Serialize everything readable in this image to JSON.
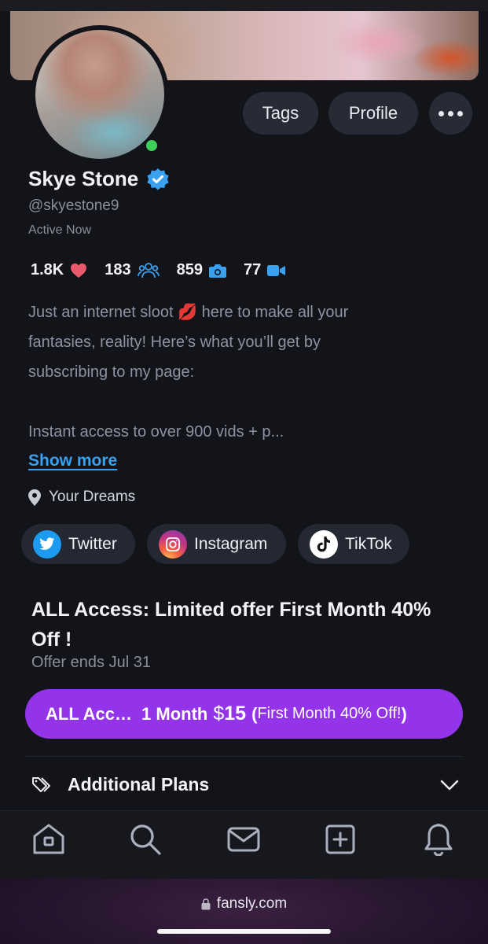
{
  "header": {
    "tags_label": "Tags",
    "profile_label": "Profile"
  },
  "profile": {
    "name": "Skye Stone",
    "handle": "@skyestone9",
    "status": "Active Now",
    "stats": {
      "likes": "1.8K",
      "subscribers": "183",
      "photos": "859",
      "videos": "77"
    },
    "bio_lines": [
      "Just an internet sloot 💋 here to make all your",
      "fantasies, reality! Here’s what you’ll get by",
      "subscribing to my page:",
      "Instant access to over 900 vids + p..."
    ],
    "show_more": "Show more ",
    "location": "Your Dreams"
  },
  "socials": {
    "twitter": "Twitter",
    "instagram": "Instagram",
    "tiktok": "TikTok"
  },
  "offer": {
    "title": "ALL Access: Limited offer First Month 40% Off !",
    "ends": "Offer ends Jul 31",
    "button_tier": "ALL Acc…",
    "button_duration": "1 Month",
    "button_currency": "$",
    "button_price": "15",
    "button_paren_open": "(",
    "button_note": "First Month 40% Off!",
    "button_paren_close": ")"
  },
  "plans": {
    "label": "Additional Plans"
  },
  "browser": {
    "url": "fansly.com"
  },
  "colors": {
    "accent": "#9333ea",
    "link": "#3aa0f0",
    "verified": "#3aa0f0",
    "online": "#3ecf5c"
  }
}
